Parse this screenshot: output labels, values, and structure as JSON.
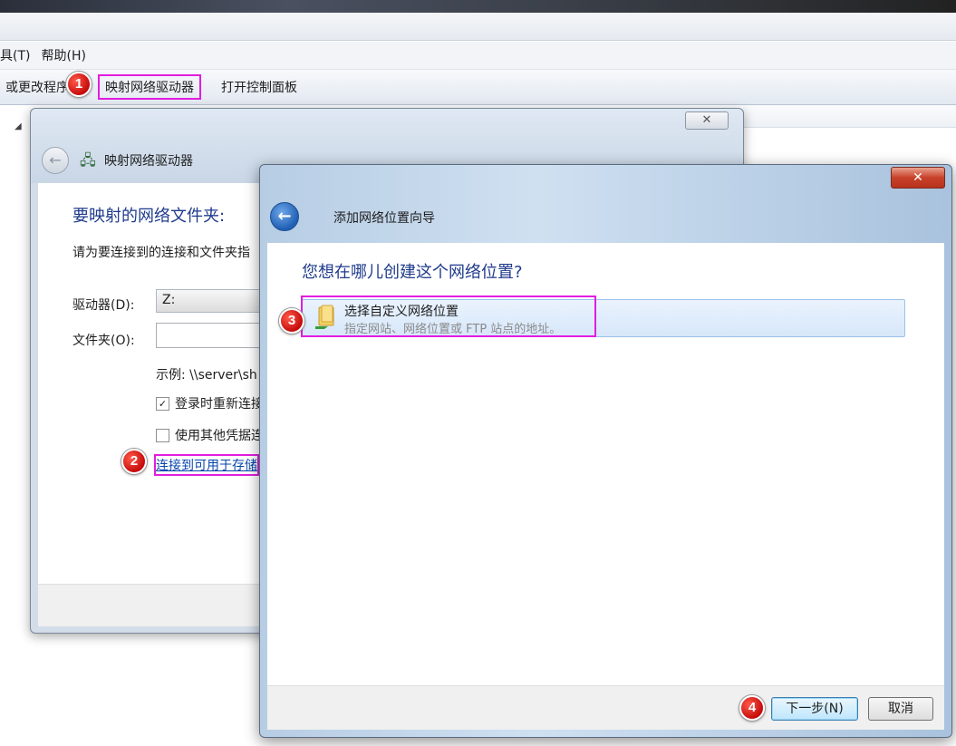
{
  "explorer": {
    "menu": [
      "具(T)",
      "帮助(H)"
    ],
    "toolbar": {
      "uninstall": "或更改程序",
      "map_drive": "映射网络驱动器",
      "control_panel": "打开控制面板"
    }
  },
  "map_drive_dialog": {
    "title": "映射网络驱动器",
    "heading": "要映射的网络文件夹:",
    "instruction": "请为要连接到的连接和文件夹指",
    "drive_label": "驱动器(D):",
    "drive_value": "Z:",
    "folder_label": "文件夹(O):",
    "example": "示例: \\\\server\\sh",
    "reconnect_label": "登录时重新连接",
    "reconnect_checked": true,
    "other_credentials_label": "使用其他凭据连",
    "other_credentials_checked": false,
    "storage_link": "连接到可用于存储"
  },
  "wizard_dialog": {
    "title": "添加网络位置向导",
    "close_glyph": "✕",
    "heading": "您想在哪儿创建这个网络位置?",
    "option_title": "选择自定义网络位置",
    "option_subtitle": "指定网站、网络位置或 FTP 站点的地址。",
    "next_button": "下一步(N)",
    "cancel_button": "取消"
  },
  "badges": [
    "1",
    "2",
    "3",
    "4"
  ],
  "colors": {
    "highlight": "#e21de0",
    "badge": "#d01616",
    "heading": "#1f3b8c",
    "link": "#0645ad"
  }
}
